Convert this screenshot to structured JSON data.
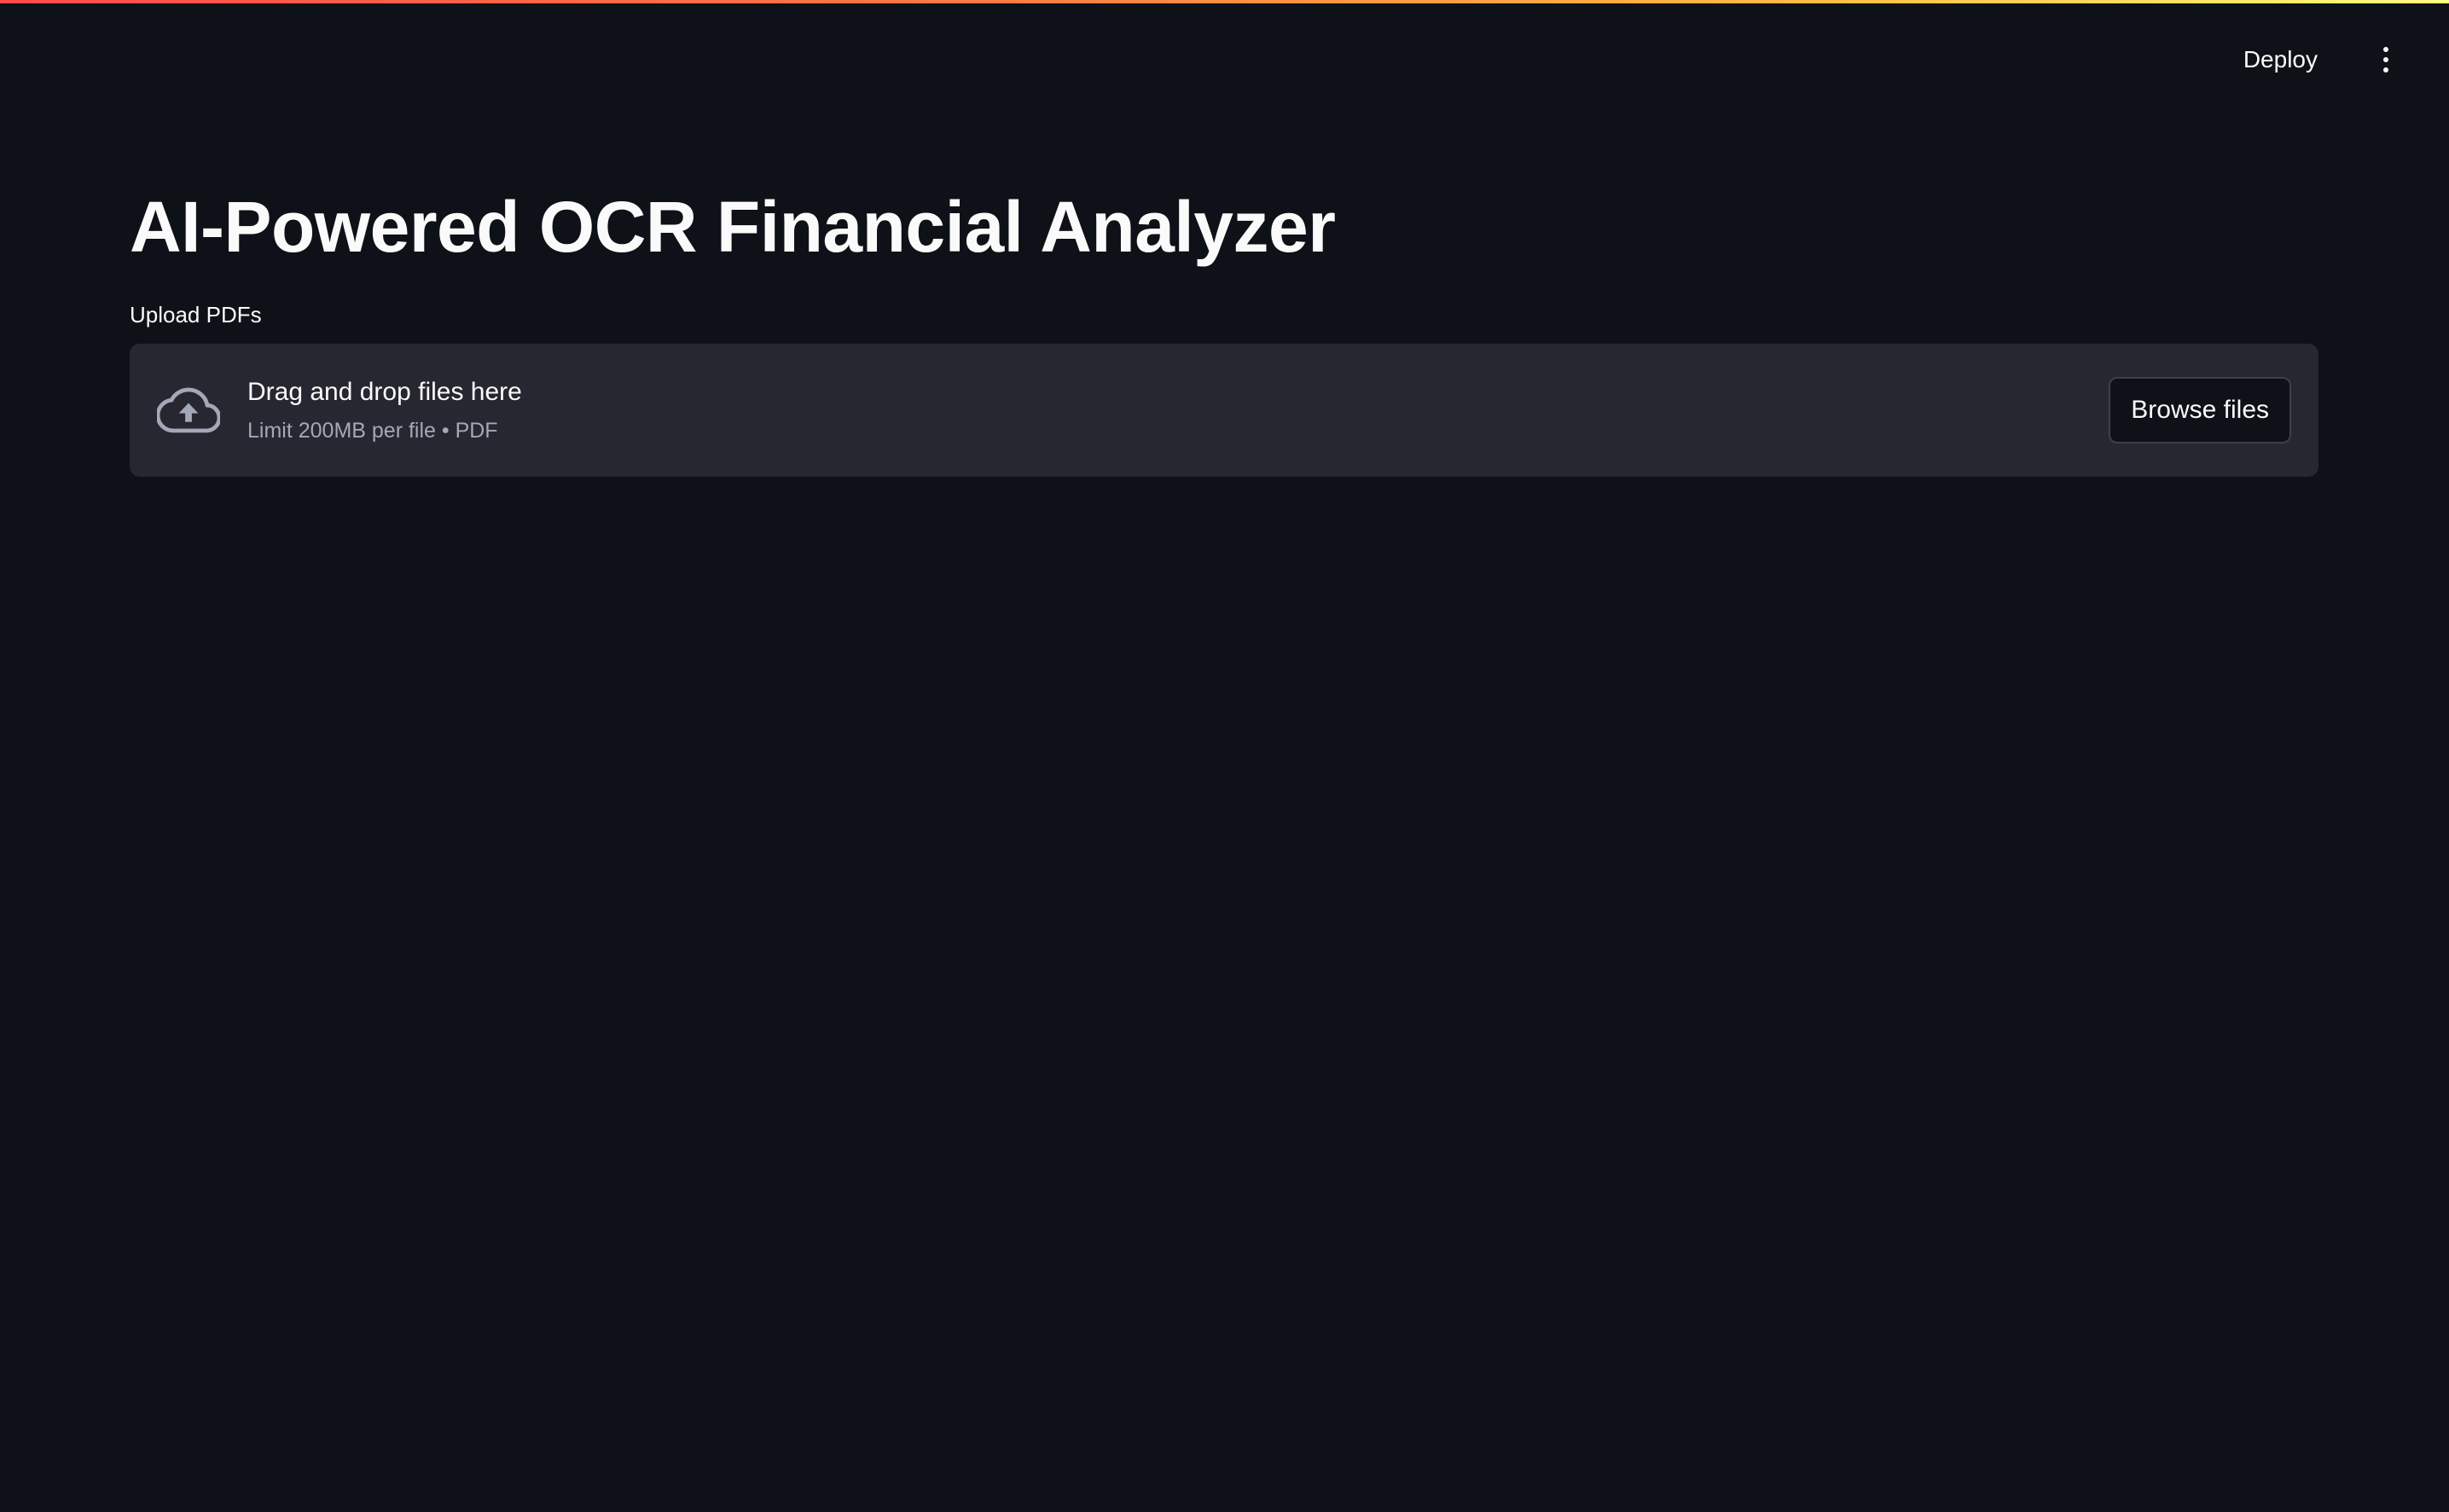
{
  "header": {
    "deploy_label": "Deploy",
    "menu_icon": "kebab-menu-icon"
  },
  "main": {
    "title": "AI-Powered OCR Financial Analyzer",
    "uploader": {
      "label": "Upload PDFs",
      "drop_text": "Drag and drop files here",
      "limit_text": "Limit 200MB per file • PDF",
      "browse_label": "Browse files",
      "icon": "cloud-upload-icon"
    }
  },
  "colors": {
    "background": "#0e1117",
    "dropzone_background": "#262730",
    "text": "#fafafa",
    "muted_text": "#a3a8b8",
    "accent_gradient_start": "#ff4b4b",
    "accent_gradient_end": "#fffd80"
  }
}
